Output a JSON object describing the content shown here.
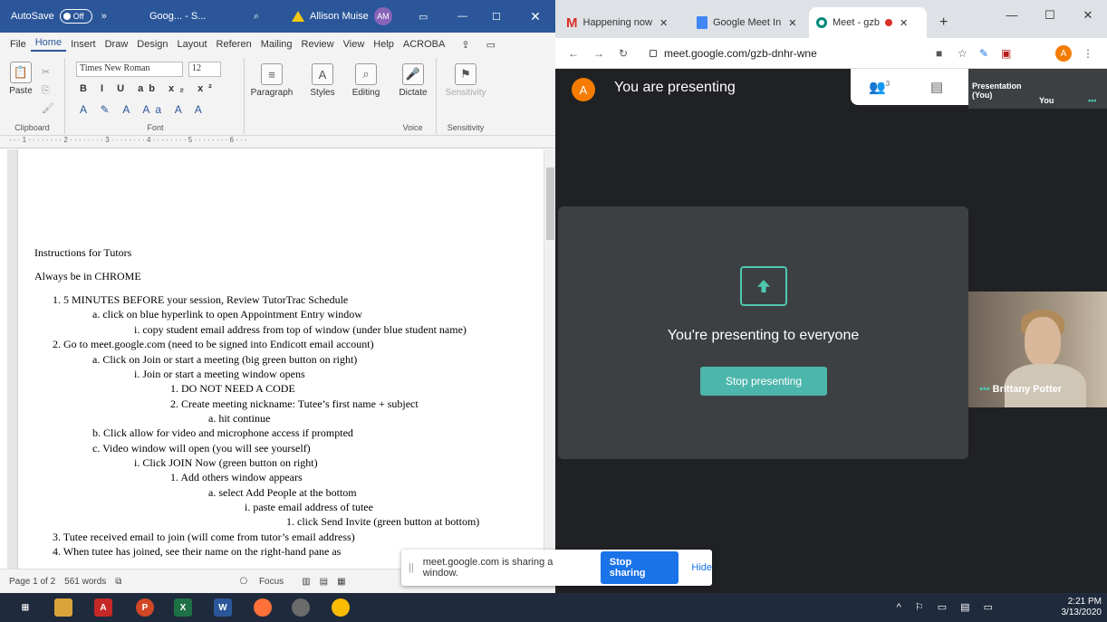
{
  "word": {
    "autosave_label": "AutoSave",
    "autosave_state": "Off",
    "title": "Goog... - S...",
    "user_name": "Allison Muise",
    "user_initials": "AM",
    "close_glyph": "✕",
    "menu": [
      "File",
      "Home",
      "Insert",
      "Draw",
      "Design",
      "Layout",
      "Referen",
      "Mailing",
      "Review",
      "View",
      "Help",
      "ACROBA"
    ],
    "ribbon": {
      "paste": "Paste",
      "font_name": "Times New Roman",
      "font_size": "12",
      "paragraph": "Paragraph",
      "styles": "Styles",
      "editing": "Editing",
      "dictate": "Dictate",
      "sensitivity": "Sensitivity",
      "group_clipboard": "Clipboard",
      "group_font": "Font",
      "group_voice": "Voice",
      "group_sensitivity": "Sensitivity"
    },
    "doc_lines": [
      "Instructions for Tutors",
      "Always be in CHROME",
      "1.   5 MINUTES BEFORE your session, Review TutorTrac Schedule",
      "a.   click on blue hyperlink to open Appointment Entry window",
      "i.   copy student email address from top of window (under blue student name)",
      "2.   Go to meet.google.com (need to be signed into Endicott email account)",
      "a.   Click on Join or start a meeting (big green button on right)",
      "i.   Join or start a meeting window opens",
      "1.   DO NOT NEED A CODE",
      "2.   Create meeting nickname: Tutee’s first name + subject",
      "a.   hit continue",
      "b.   Click allow for video and microphone access if prompted",
      "c.   Video window will open (you will see yourself)",
      "i.   Click JOIN Now (green button on right)",
      "1.   Add others window appears",
      "a.   select Add People at the bottom",
      "i.   paste email address of tutee",
      "1.   click Send Invite (green button at bottom)",
      "3.   Tutee received email to join (will come from tutor’s email address)",
      "4.   When tutee has joined, see their name on the right-hand pane as"
    ],
    "status_page": "Page 1 of 2",
    "status_words": "561 words",
    "status_focus": "Focus"
  },
  "chrome": {
    "tabs": [
      {
        "label": "Happening now",
        "icon": "gmail-icon"
      },
      {
        "label": "Google Meet In",
        "icon": "google-docs-icon"
      },
      {
        "label": "Meet - gzb",
        "icon": "meet-icon"
      }
    ],
    "new_tab": "+",
    "url": "meet.google.com/gzb-dnhr-wne",
    "profile_initial": "A"
  },
  "meet": {
    "user_initial": "A",
    "presenting_label": "You are presenting",
    "participants_count": "3",
    "tile_presentation": "Presentation (You)",
    "tile_you": "You",
    "present_message": "You're presenting to everyone",
    "stop_presenting": "Stop presenting",
    "participant_name": "Brittany Potter",
    "more_dots": "•••"
  },
  "share_bar": {
    "message": "meet.google.com is sharing a window.",
    "stop": "Stop sharing",
    "hide": "Hide"
  },
  "taskbar": {
    "time": "2:21 PM",
    "date": "3/13/2020"
  },
  "colors": {
    "word_blue": "#2b579a",
    "meet_teal": "#4db6ac",
    "meet_bg": "#202124",
    "share_blue": "#1a73e8"
  }
}
